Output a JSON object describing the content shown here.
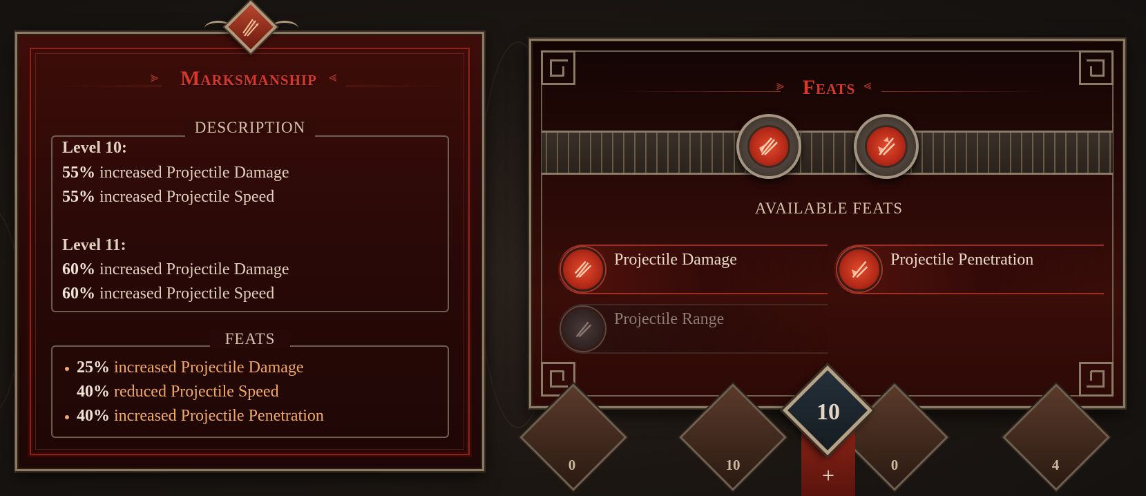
{
  "skill": {
    "title": "Marksmanship",
    "description_label": "DESCRIPTION",
    "levels": [
      {
        "heading": "Level 10:",
        "lines": [
          {
            "value": "55%",
            "text": "increased Projectile Damage"
          },
          {
            "value": "55%",
            "text": "increased Projectile Speed"
          }
        ]
      },
      {
        "heading": "Level 11:",
        "lines": [
          {
            "value": "60%",
            "text": "increased Projectile Damage"
          },
          {
            "value": "60%",
            "text": "increased Projectile Speed"
          }
        ]
      }
    ],
    "feats_label": "FEATS",
    "feat_effects": [
      {
        "value": "25%",
        "text": "increased Projectile Damage"
      },
      {
        "value": "40%",
        "text": "reduced Projectile Speed"
      },
      {
        "value": "40%",
        "text": "increased Projectile Penetration"
      }
    ]
  },
  "feats_panel": {
    "title": "Feats",
    "available_label": "AVAILABLE FEATS",
    "available": [
      {
        "name": "Projectile Damage",
        "state": "active"
      },
      {
        "name": "Projectile Penetration",
        "state": "active"
      },
      {
        "name": "Projectile Range",
        "state": "locked"
      }
    ],
    "equipped_slots": [
      {
        "icon": "projectile-damage-icon"
      },
      {
        "icon": "projectile-penetration-icon"
      }
    ]
  },
  "bottom_bar": {
    "tabs": [
      {
        "count": "0",
        "icon": "warrior-icon"
      },
      {
        "count": "10",
        "icon": "spear-icon"
      },
      {
        "count": "0",
        "icon": "beast-icon"
      },
      {
        "count": "4",
        "icon": "hero-icon"
      }
    ],
    "level": "10",
    "plus_label": "+"
  },
  "colors": {
    "accent_red": "#d8382a",
    "highlight_orange": "#f0a868",
    "frame_bronze": "#8c7a63"
  }
}
